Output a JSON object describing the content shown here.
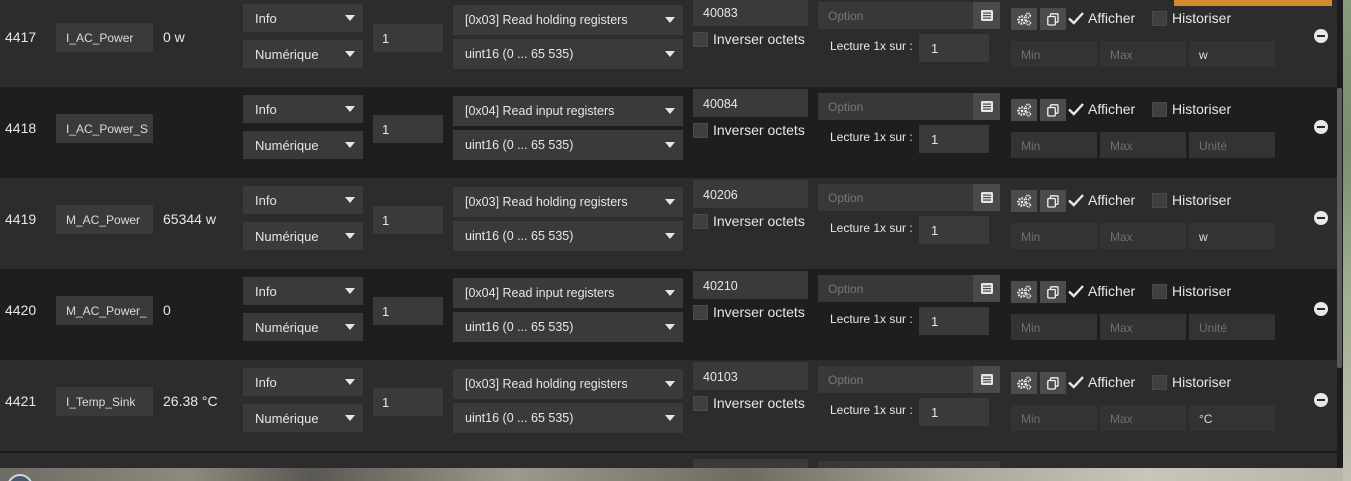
{
  "rows": [
    {
      "id": "4417",
      "name": "I_AC_Power",
      "value": "0 w",
      "type": "Info",
      "subtype": "Numérique",
      "count": "1",
      "function": "[0x03] Read holding registers",
      "format": "uint16 (0 ... 65 535)",
      "address": "40083",
      "invert_label": "Inverser octets",
      "option_placeholder": "Option",
      "lecture_label": "Lecture 1x sur :",
      "lecture_value": "1",
      "afficher_label": "Afficher",
      "historiser_label": "Historiser",
      "min_placeholder": "Min",
      "max_placeholder": "Max",
      "unit": "w"
    },
    {
      "id": "4418",
      "name": "I_AC_Power_S",
      "value": "",
      "type": "Info",
      "subtype": "Numérique",
      "count": "1",
      "function": "[0x04] Read input registers",
      "format": "uint16 (0 ... 65 535)",
      "address": "40084",
      "invert_label": "Inverser octets",
      "option_placeholder": "Option",
      "lecture_label": "Lecture 1x sur :",
      "lecture_value": "1",
      "afficher_label": "Afficher",
      "historiser_label": "Historiser",
      "min_placeholder": "Min",
      "max_placeholder": "Max",
      "unit": "Unité"
    },
    {
      "id": "4419",
      "name": "M_AC_Power",
      "value": "65344 w",
      "type": "Info",
      "subtype": "Numérique",
      "count": "1",
      "function": "[0x03] Read holding registers",
      "format": "uint16 (0 ... 65 535)",
      "address": "40206",
      "invert_label": "Inverser octets",
      "option_placeholder": "Option",
      "lecture_label": "Lecture 1x sur :",
      "lecture_value": "1",
      "afficher_label": "Afficher",
      "historiser_label": "Historiser",
      "min_placeholder": "Min",
      "max_placeholder": "Max",
      "unit": "w"
    },
    {
      "id": "4420",
      "name": "M_AC_Power_",
      "value": "0",
      "type": "Info",
      "subtype": "Numérique",
      "count": "1",
      "function": "[0x04] Read input registers",
      "format": "uint16 (0 ... 65 535)",
      "address": "40210",
      "invert_label": "Inverser octets",
      "option_placeholder": "Option",
      "lecture_label": "Lecture 1x sur :",
      "lecture_value": "1",
      "afficher_label": "Afficher",
      "historiser_label": "Historiser",
      "min_placeholder": "Min",
      "max_placeholder": "Max",
      "unit": "Unité"
    },
    {
      "id": "4421",
      "name": "I_Temp_Sink",
      "value": "26.38 °C",
      "type": "Info",
      "subtype": "Numérique",
      "count": "1",
      "function": "[0x03] Read holding registers",
      "format": "uint16 (0 ... 65 535)",
      "address": "40103",
      "invert_label": "Inverser octets",
      "option_placeholder": "Option",
      "lecture_label": "Lecture 1x sur :",
      "lecture_value": "1",
      "afficher_label": "Afficher",
      "historiser_label": "Historiser",
      "min_placeholder": "Min",
      "max_placeholder": "Max",
      "unit": "°C"
    }
  ],
  "row_state": [
    {
      "afficher_checked": true,
      "historiser_checked": false,
      "invert_checked": false,
      "unit_is_placeholder": false
    },
    {
      "afficher_checked": true,
      "historiser_checked": false,
      "invert_checked": false,
      "unit_is_placeholder": true
    },
    {
      "afficher_checked": true,
      "historiser_checked": false,
      "invert_checked": false,
      "unit_is_placeholder": false
    },
    {
      "afficher_checked": true,
      "historiser_checked": false,
      "invert_checked": false,
      "unit_is_placeholder": true
    },
    {
      "afficher_checked": true,
      "historiser_checked": false,
      "invert_checked": false,
      "unit_is_placeholder": false
    }
  ],
  "icons": {
    "config": "cogs-icon",
    "copy": "copy-icon",
    "list": "list-icon",
    "remove": "minus-circle-icon",
    "check": "check-icon"
  },
  "colors": {
    "accent": "#d3892f",
    "row_odd": "#2c2c2c",
    "row_even": "#1e1e1e",
    "input_bg": "#3a3a3a"
  }
}
